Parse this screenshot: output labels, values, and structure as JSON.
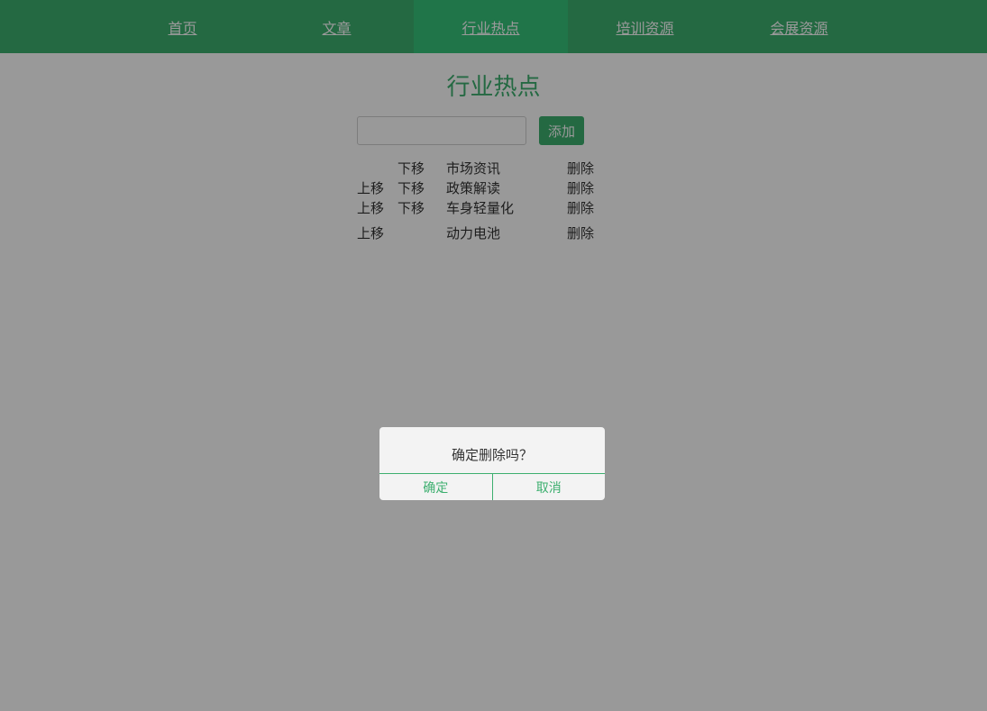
{
  "nav": {
    "items": [
      {
        "label": "首页"
      },
      {
        "label": "文章"
      },
      {
        "label": "行业热点"
      },
      {
        "label": "培训资源"
      },
      {
        "label": "会展资源"
      }
    ],
    "active_index": 2
  },
  "page": {
    "title": "行业热点",
    "add_input_value": "",
    "add_button_label": "添加"
  },
  "list": {
    "rows": [
      {
        "up": "",
        "down": "下移",
        "name": "市场资讯",
        "delete": "删除"
      },
      {
        "up": "上移",
        "down": "下移",
        "name": "政策解读",
        "delete": "删除"
      },
      {
        "up": "上移",
        "down": "下移",
        "name": "车身轻量化",
        "delete": "删除"
      },
      {
        "up": "上移",
        "down": "",
        "name": "动力电池",
        "delete": "删除"
      }
    ]
  },
  "dialog": {
    "message": "确定删除吗？",
    "confirm_label": "确定",
    "cancel_label": "取消"
  },
  "colors": {
    "brand_green": "#3daf6f",
    "active_tab": "#36c47b",
    "overlay": "rgba(0,0,0,0.4)"
  }
}
